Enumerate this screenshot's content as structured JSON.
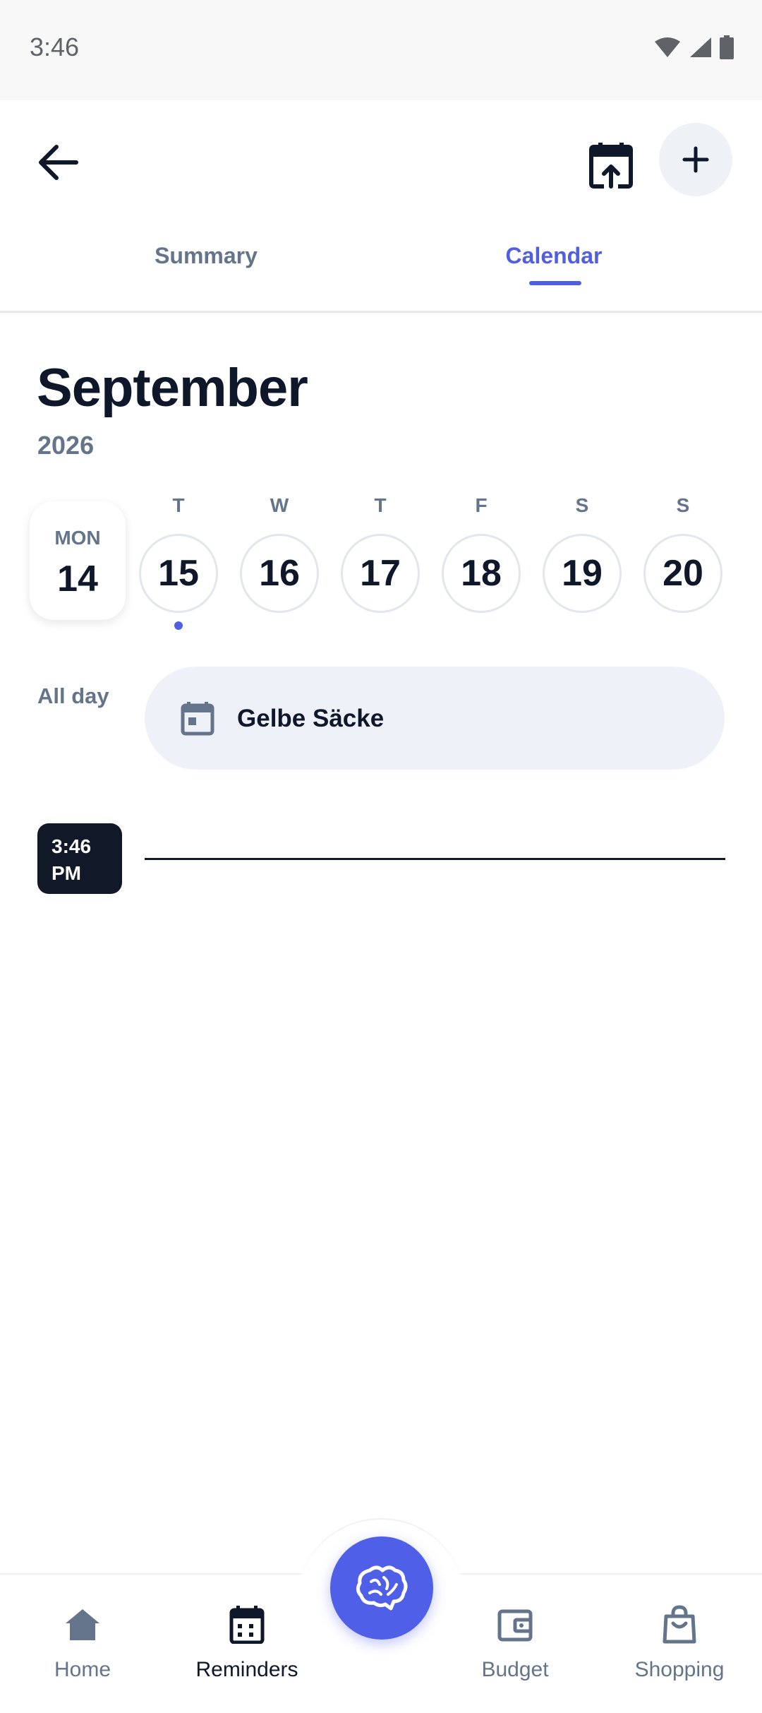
{
  "status_bar": {
    "time": "3:46"
  },
  "header": {
    "back_icon": "arrow-left-icon",
    "export_icon": "calendar-export-icon",
    "add_icon": "plus-icon"
  },
  "tabs": [
    {
      "label": "Summary",
      "active": false
    },
    {
      "label": "Calendar",
      "active": true
    }
  ],
  "calendar": {
    "month": "September",
    "year": "2026",
    "today": {
      "dow": "MON",
      "day": "14"
    },
    "days": [
      {
        "letter": "T",
        "day": "15",
        "has_event": true
      },
      {
        "letter": "W",
        "day": "16",
        "has_event": false
      },
      {
        "letter": "T",
        "day": "17",
        "has_event": false
      },
      {
        "letter": "F",
        "day": "18",
        "has_event": false
      },
      {
        "letter": "S",
        "day": "19",
        "has_event": false
      },
      {
        "letter": "S",
        "day": "20",
        "has_event": false
      }
    ],
    "all_day_label": "All day",
    "all_day_event": "Gelbe Säcke",
    "now_time": "3:46\nPM"
  },
  "bottom_nav": {
    "items": [
      {
        "label": "Home",
        "icon": "home-icon",
        "active": false
      },
      {
        "label": "Reminders",
        "icon": "calendar-icon",
        "active": true
      },
      {
        "label": "Budget",
        "icon": "wallet-icon",
        "active": false
      },
      {
        "label": "Shopping",
        "icon": "shopping-bag-icon",
        "active": false
      }
    ],
    "fab_icon": "brain-icon"
  },
  "colors": {
    "accent": "#4f5fe0",
    "text_primary": "#0f172a",
    "text_secondary": "#64748b",
    "card_bg": "#eef1f7"
  }
}
